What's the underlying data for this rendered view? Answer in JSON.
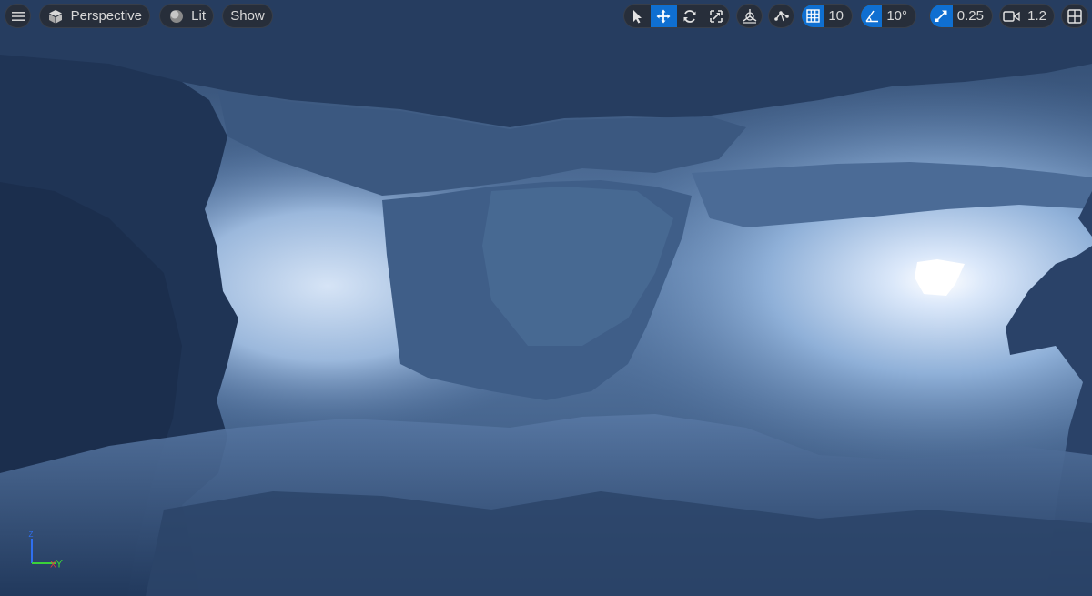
{
  "toolbar": {
    "menu_icon": "hamburger-menu-icon",
    "perspective": {
      "icon": "cube-icon",
      "label": "Perspective"
    },
    "lit": {
      "icon": "lit-sphere-icon",
      "label": "Lit"
    },
    "show": {
      "label": "Show"
    },
    "transform_tools": [
      {
        "name": "select",
        "icon": "cursor-icon",
        "active": false
      },
      {
        "name": "move",
        "icon": "move-icon",
        "active": true
      },
      {
        "name": "rotate",
        "icon": "rotate-icon",
        "active": false
      },
      {
        "name": "scale",
        "icon": "scale-icon",
        "active": false
      }
    ],
    "world_local_icon": "world-local-icon",
    "surface_snap_icon": "surface-snap-icon",
    "grid_snap": {
      "icon": "grid-icon",
      "value": "10",
      "active": true
    },
    "rotation_snap": {
      "icon": "angle-icon",
      "value": "10°",
      "active": true
    },
    "scale_snap": {
      "icon": "scale-snap-icon",
      "value": "0.25",
      "active": true
    },
    "camera_speed": {
      "icon": "camera-icon",
      "value": "1.2"
    },
    "layout_icon": "viewport-layout-icon"
  },
  "axis_gizmo": {
    "labels": [
      "Z",
      "X",
      "Y"
    ]
  },
  "colors": {
    "accent": "#0f6fd1",
    "toolbar_bg": "#282c34",
    "axis_x": "#e23a3a",
    "axis_y": "#3ad23a",
    "axis_z": "#2f6ff0"
  }
}
